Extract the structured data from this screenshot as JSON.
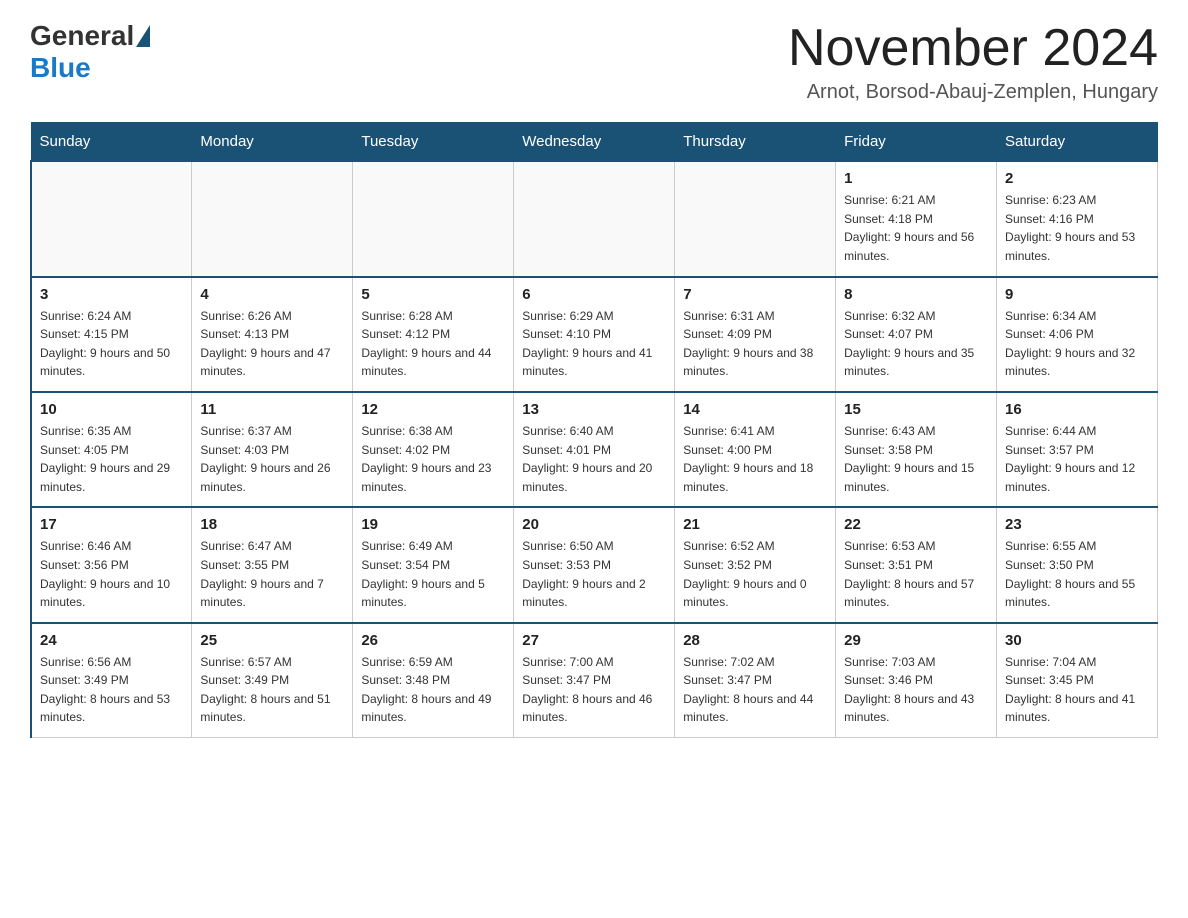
{
  "logo": {
    "general": "General",
    "blue": "Blue"
  },
  "title": "November 2024",
  "location": "Arnot, Borsod-Abauj-Zemplen, Hungary",
  "weekdays": [
    "Sunday",
    "Monday",
    "Tuesday",
    "Wednesday",
    "Thursday",
    "Friday",
    "Saturday"
  ],
  "weeks": [
    [
      {
        "day": "",
        "info": ""
      },
      {
        "day": "",
        "info": ""
      },
      {
        "day": "",
        "info": ""
      },
      {
        "day": "",
        "info": ""
      },
      {
        "day": "",
        "info": ""
      },
      {
        "day": "1",
        "info": "Sunrise: 6:21 AM\nSunset: 4:18 PM\nDaylight: 9 hours and 56 minutes."
      },
      {
        "day": "2",
        "info": "Sunrise: 6:23 AM\nSunset: 4:16 PM\nDaylight: 9 hours and 53 minutes."
      }
    ],
    [
      {
        "day": "3",
        "info": "Sunrise: 6:24 AM\nSunset: 4:15 PM\nDaylight: 9 hours and 50 minutes."
      },
      {
        "day": "4",
        "info": "Sunrise: 6:26 AM\nSunset: 4:13 PM\nDaylight: 9 hours and 47 minutes."
      },
      {
        "day": "5",
        "info": "Sunrise: 6:28 AM\nSunset: 4:12 PM\nDaylight: 9 hours and 44 minutes."
      },
      {
        "day": "6",
        "info": "Sunrise: 6:29 AM\nSunset: 4:10 PM\nDaylight: 9 hours and 41 minutes."
      },
      {
        "day": "7",
        "info": "Sunrise: 6:31 AM\nSunset: 4:09 PM\nDaylight: 9 hours and 38 minutes."
      },
      {
        "day": "8",
        "info": "Sunrise: 6:32 AM\nSunset: 4:07 PM\nDaylight: 9 hours and 35 minutes."
      },
      {
        "day": "9",
        "info": "Sunrise: 6:34 AM\nSunset: 4:06 PM\nDaylight: 9 hours and 32 minutes."
      }
    ],
    [
      {
        "day": "10",
        "info": "Sunrise: 6:35 AM\nSunset: 4:05 PM\nDaylight: 9 hours and 29 minutes."
      },
      {
        "day": "11",
        "info": "Sunrise: 6:37 AM\nSunset: 4:03 PM\nDaylight: 9 hours and 26 minutes."
      },
      {
        "day": "12",
        "info": "Sunrise: 6:38 AM\nSunset: 4:02 PM\nDaylight: 9 hours and 23 minutes."
      },
      {
        "day": "13",
        "info": "Sunrise: 6:40 AM\nSunset: 4:01 PM\nDaylight: 9 hours and 20 minutes."
      },
      {
        "day": "14",
        "info": "Sunrise: 6:41 AM\nSunset: 4:00 PM\nDaylight: 9 hours and 18 minutes."
      },
      {
        "day": "15",
        "info": "Sunrise: 6:43 AM\nSunset: 3:58 PM\nDaylight: 9 hours and 15 minutes."
      },
      {
        "day": "16",
        "info": "Sunrise: 6:44 AM\nSunset: 3:57 PM\nDaylight: 9 hours and 12 minutes."
      }
    ],
    [
      {
        "day": "17",
        "info": "Sunrise: 6:46 AM\nSunset: 3:56 PM\nDaylight: 9 hours and 10 minutes."
      },
      {
        "day": "18",
        "info": "Sunrise: 6:47 AM\nSunset: 3:55 PM\nDaylight: 9 hours and 7 minutes."
      },
      {
        "day": "19",
        "info": "Sunrise: 6:49 AM\nSunset: 3:54 PM\nDaylight: 9 hours and 5 minutes."
      },
      {
        "day": "20",
        "info": "Sunrise: 6:50 AM\nSunset: 3:53 PM\nDaylight: 9 hours and 2 minutes."
      },
      {
        "day": "21",
        "info": "Sunrise: 6:52 AM\nSunset: 3:52 PM\nDaylight: 9 hours and 0 minutes."
      },
      {
        "day": "22",
        "info": "Sunrise: 6:53 AM\nSunset: 3:51 PM\nDaylight: 8 hours and 57 minutes."
      },
      {
        "day": "23",
        "info": "Sunrise: 6:55 AM\nSunset: 3:50 PM\nDaylight: 8 hours and 55 minutes."
      }
    ],
    [
      {
        "day": "24",
        "info": "Sunrise: 6:56 AM\nSunset: 3:49 PM\nDaylight: 8 hours and 53 minutes."
      },
      {
        "day": "25",
        "info": "Sunrise: 6:57 AM\nSunset: 3:49 PM\nDaylight: 8 hours and 51 minutes."
      },
      {
        "day": "26",
        "info": "Sunrise: 6:59 AM\nSunset: 3:48 PM\nDaylight: 8 hours and 49 minutes."
      },
      {
        "day": "27",
        "info": "Sunrise: 7:00 AM\nSunset: 3:47 PM\nDaylight: 8 hours and 46 minutes."
      },
      {
        "day": "28",
        "info": "Sunrise: 7:02 AM\nSunset: 3:47 PM\nDaylight: 8 hours and 44 minutes."
      },
      {
        "day": "29",
        "info": "Sunrise: 7:03 AM\nSunset: 3:46 PM\nDaylight: 8 hours and 43 minutes."
      },
      {
        "day": "30",
        "info": "Sunrise: 7:04 AM\nSunset: 3:45 PM\nDaylight: 8 hours and 41 minutes."
      }
    ]
  ]
}
